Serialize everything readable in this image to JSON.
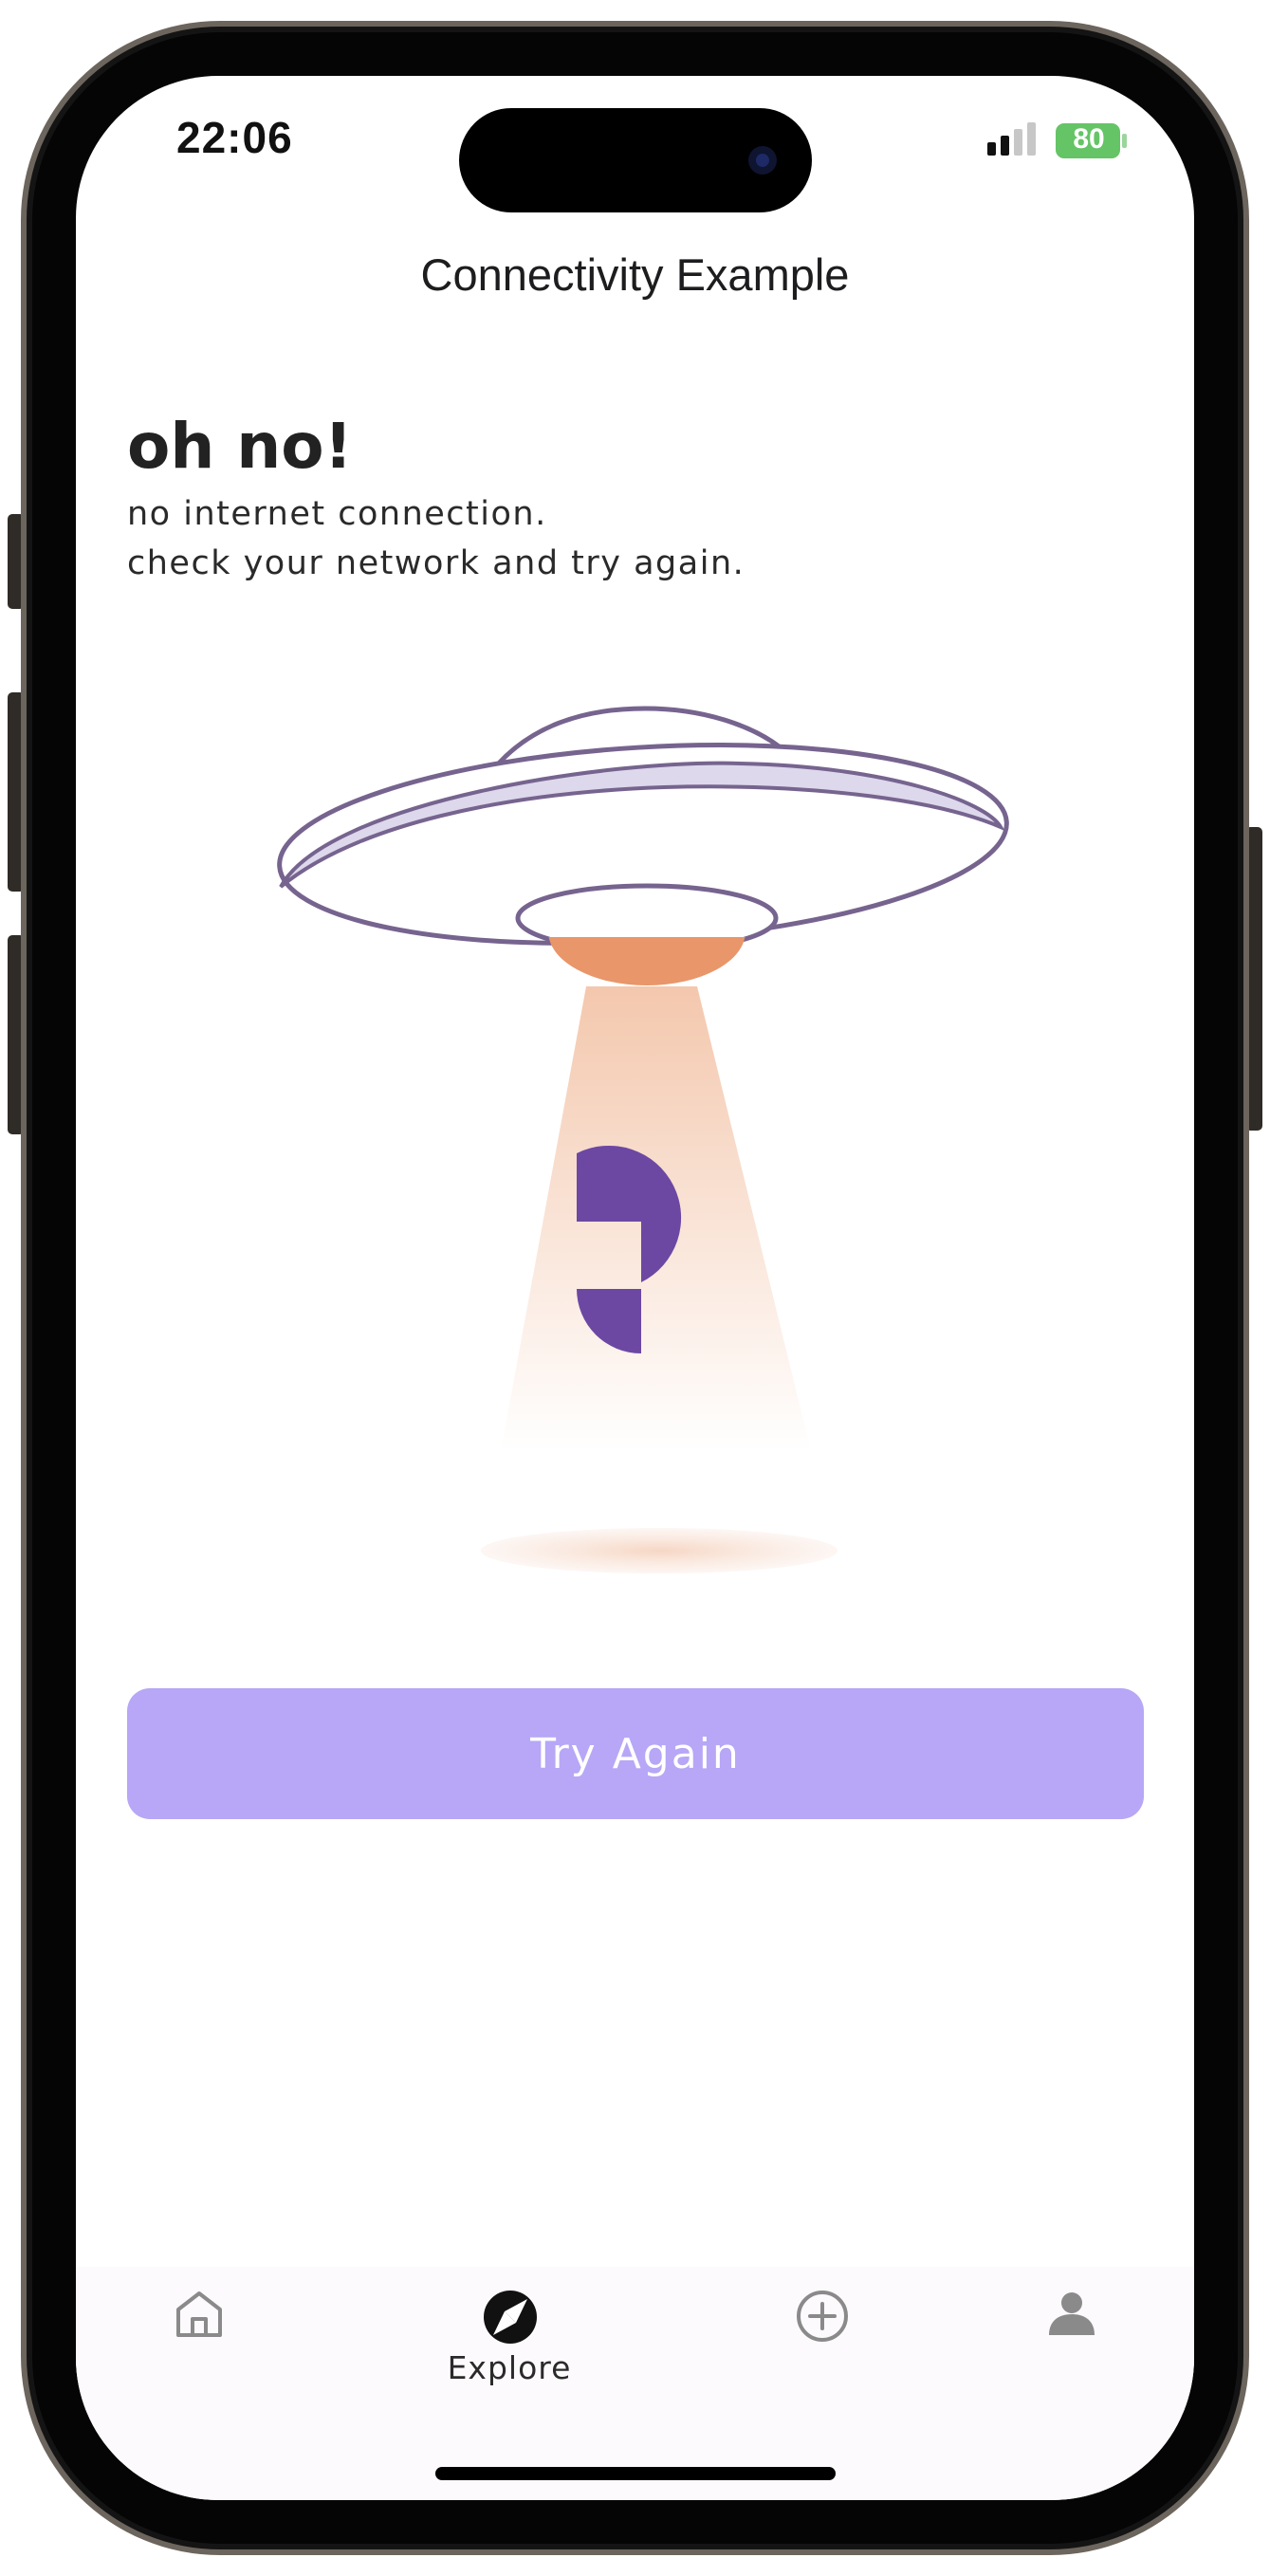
{
  "status_bar": {
    "time": "22:06",
    "battery_level": "80",
    "battery_color": "#65c466",
    "signal_icon": "cellular-signal-icon"
  },
  "nav_bar": {
    "title": "Connectivity Example"
  },
  "error": {
    "headline": "oh no!",
    "message_line1": "no internet connection.",
    "message_line2": "check your network and try again.",
    "illustration": "ufo-abducting-logo-illustration"
  },
  "actions": {
    "try_again_label": "Try Again",
    "button_color": "#b7a7f6"
  },
  "tab_bar": {
    "items": [
      {
        "icon": "home-icon",
        "label": ""
      },
      {
        "icon": "compass-icon",
        "label": "Explore",
        "selected": true
      },
      {
        "icon": "add-circle-icon",
        "label": ""
      },
      {
        "icon": "person-icon",
        "label": ""
      }
    ]
  },
  "colors": {
    "ufo_outline": "#76648f",
    "ufo_fill": "#ddd8ec",
    "beam": "#f0b592",
    "light": "#e8966a",
    "logo": "#6c48a3"
  }
}
